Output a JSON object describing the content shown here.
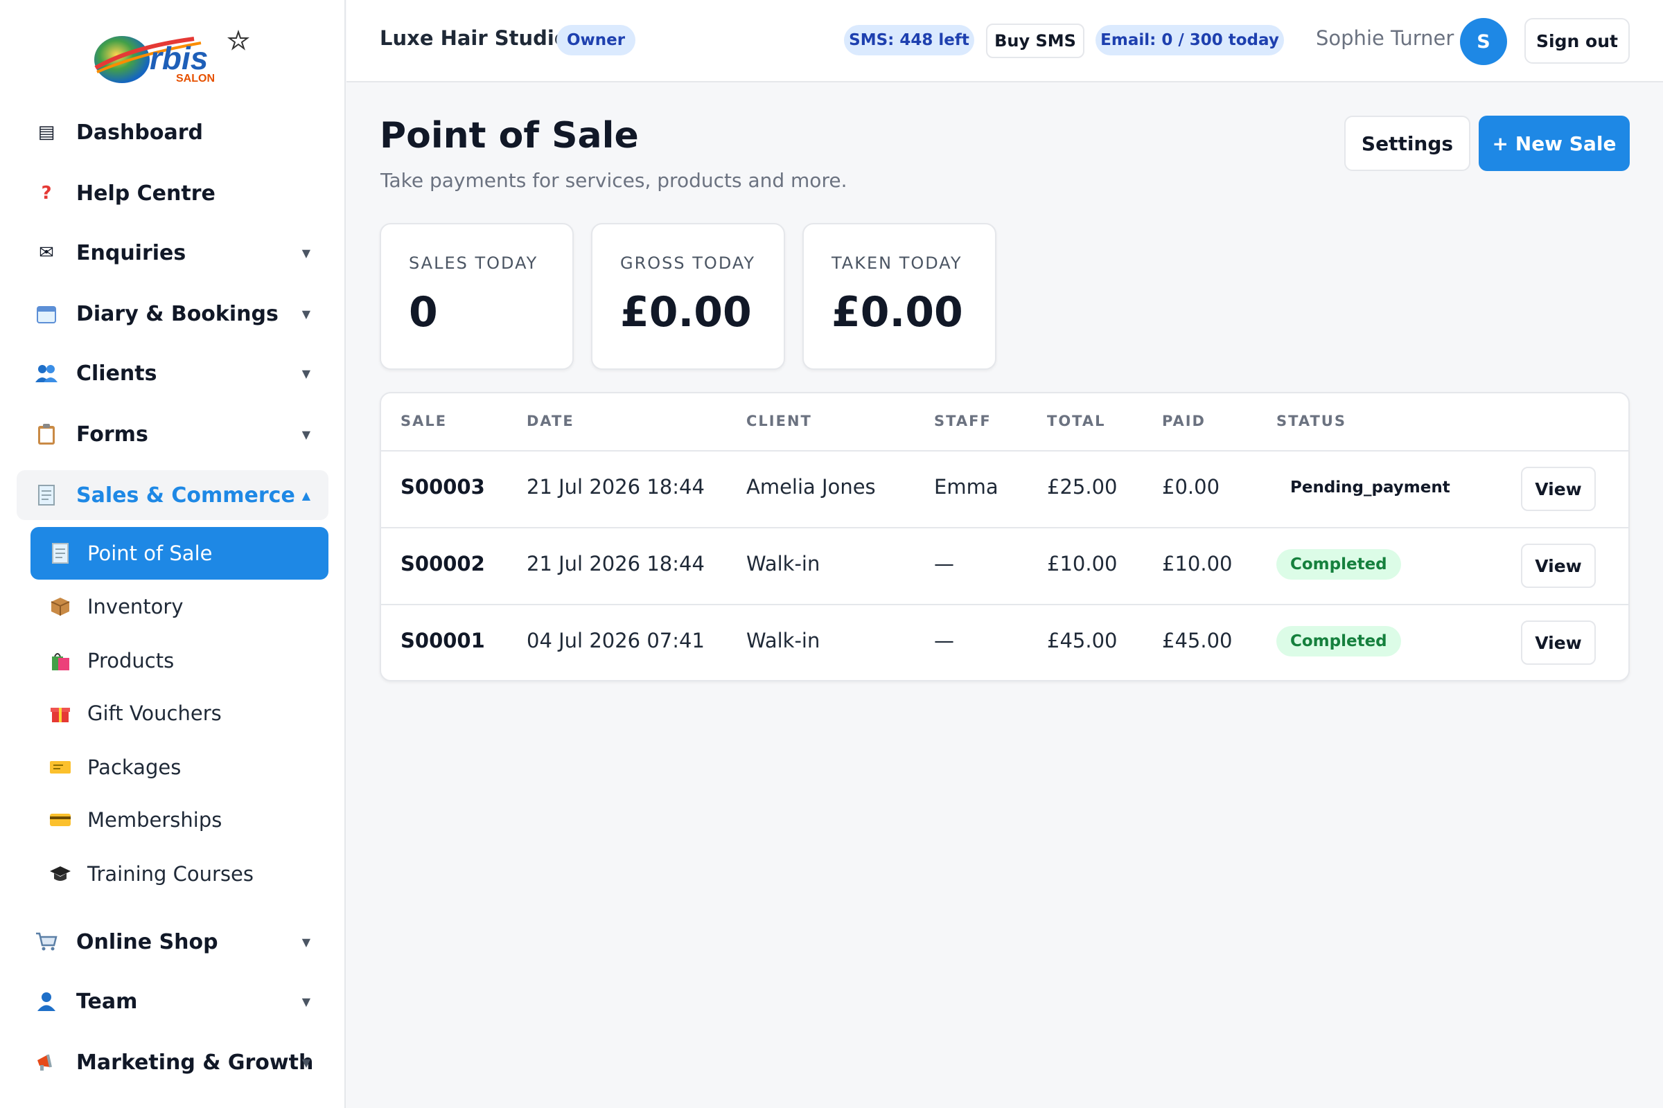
{
  "brand": {
    "logo_text": "rbis",
    "logo_sub": "SALON"
  },
  "sidebar": {
    "items": [
      {
        "label": "Dashboard",
        "icon": "dashboard-icon"
      },
      {
        "label": "Help Centre",
        "icon": "help-icon"
      },
      {
        "label": "Enquiries",
        "icon": "envelope-icon"
      },
      {
        "label": "Diary & Bookings",
        "icon": "calendar-icon"
      },
      {
        "label": "Clients",
        "icon": "clients-icon"
      },
      {
        "label": "Forms",
        "icon": "clipboard-icon"
      },
      {
        "label": "Sales & Commerce",
        "icon": "receipt-icon"
      },
      {
        "label": "Online Shop",
        "icon": "cart-icon"
      },
      {
        "label": "Team",
        "icon": "person-icon"
      },
      {
        "label": "Marketing & Growth",
        "icon": "megaphone-icon"
      }
    ],
    "sub_items": [
      {
        "label": "Point of Sale",
        "icon": "receipt-icon"
      },
      {
        "label": "Inventory",
        "icon": "box-icon"
      },
      {
        "label": "Products",
        "icon": "shopping-bag-icon"
      },
      {
        "label": "Gift Vouchers",
        "icon": "gift-icon"
      },
      {
        "label": "Packages",
        "icon": "ticket-icon"
      },
      {
        "label": "Memberships",
        "icon": "card-icon"
      },
      {
        "label": "Training Courses",
        "icon": "graduation-cap-icon"
      }
    ]
  },
  "header": {
    "studio": "Luxe Hair Studio",
    "role": "Owner",
    "sms": "SMS: 448 left",
    "buy_sms": "Buy SMS",
    "email": "Email: 0 / 300 today",
    "user": "Sophie Turner",
    "avatar": "S",
    "sign_out": "Sign out"
  },
  "page": {
    "title": "Point of Sale",
    "subtitle": "Take payments for services, products and more.",
    "settings": "Settings",
    "new_sale": "+ New Sale"
  },
  "stats": [
    {
      "label": "SALES TODAY",
      "value": "0"
    },
    {
      "label": "GROSS TODAY",
      "value": "£0.00"
    },
    {
      "label": "TAKEN TODAY",
      "value": "£0.00"
    }
  ],
  "table": {
    "headers": [
      "SALE",
      "DATE",
      "CLIENT",
      "STAFF",
      "TOTAL",
      "PAID",
      "STATUS"
    ],
    "view_label": "View",
    "rows": [
      {
        "sale": "S00003",
        "date": "21 Jul 2026 18:44",
        "client": "Amelia Jones",
        "staff": "Emma",
        "total": "£25.00",
        "paid": "£0.00",
        "status": "Pending_payment"
      },
      {
        "sale": "S00002",
        "date": "21 Jul 2026 18:44",
        "client": "Walk-in",
        "staff": "—",
        "total": "£10.00",
        "paid": "£10.00",
        "status": "Completed"
      },
      {
        "sale": "S00001",
        "date": "04 Jul 2026 07:41",
        "client": "Walk-in",
        "staff": "—",
        "total": "£45.00",
        "paid": "£45.00",
        "status": "Completed"
      }
    ]
  },
  "colors": {
    "accent": "#1e88e5",
    "success": "#15803d",
    "success_bg": "#dcfce7",
    "pill_bg": "#dbeafe"
  }
}
